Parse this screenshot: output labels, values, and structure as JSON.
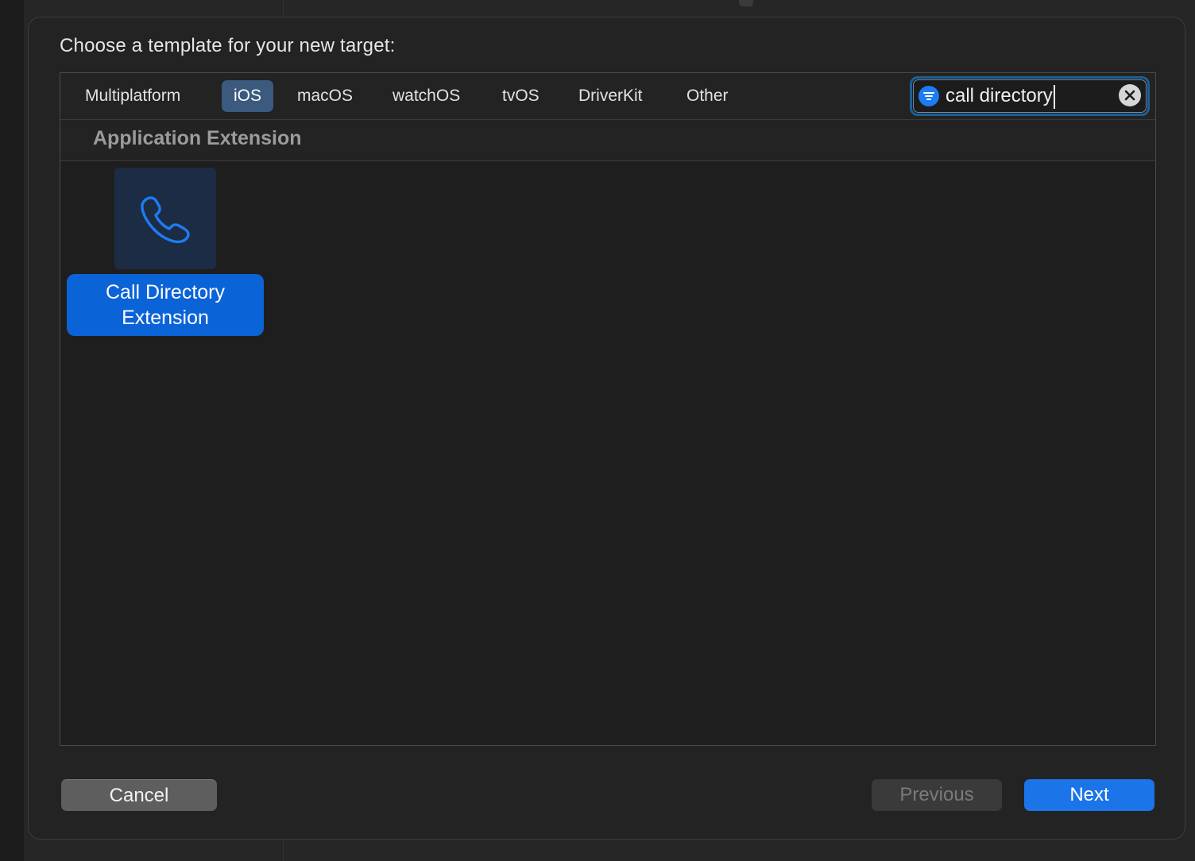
{
  "dialog": {
    "title": "Choose a template for your new target:"
  },
  "platform_tabs": [
    {
      "label": "Multiplatform",
      "selected": false
    },
    {
      "label": "iOS",
      "selected": true
    },
    {
      "label": "macOS",
      "selected": false
    },
    {
      "label": "watchOS",
      "selected": false
    },
    {
      "label": "tvOS",
      "selected": false
    },
    {
      "label": "DriverKit",
      "selected": false
    },
    {
      "label": "Other",
      "selected": false
    }
  ],
  "search": {
    "value": "call directory",
    "icon": "filter-icon",
    "clear_icon": "clear-icon"
  },
  "section": {
    "title": "Application Extension"
  },
  "templates": [
    {
      "name": "Call Directory Extension",
      "line1": "Call Directory",
      "line2": "Extension",
      "icon": "phone-icon",
      "selected": true
    }
  ],
  "buttons": {
    "cancel": "Cancel",
    "previous": "Previous",
    "next": "Next"
  },
  "colors": {
    "accent": "#1b74e8",
    "selection": "#0b63d8",
    "tab_selected": "#3b5a7e",
    "icon_blue": "#1d7cf2"
  }
}
